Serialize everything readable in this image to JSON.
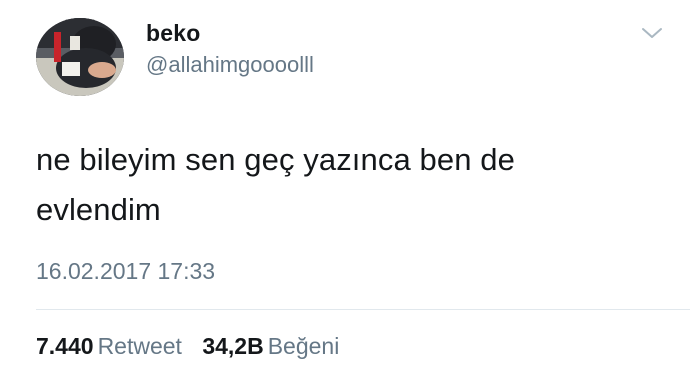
{
  "user": {
    "display_name": "beko",
    "handle": "@allahimgoooolll",
    "avatar_icon": "profile-photo"
  },
  "menu": {
    "icon": "chevron-down-icon"
  },
  "tweet": {
    "text": "ne bileyim sen geç yazınca ben de evlendim",
    "timestamp": "16.02.2017 17:33"
  },
  "stats": {
    "retweets": {
      "count": "7.440",
      "label": "Retweet"
    },
    "likes": {
      "count": "34,2B",
      "label": "Beğeni"
    }
  },
  "colors": {
    "text": "#14171a",
    "muted": "#657786",
    "divider": "#e1e8ed"
  }
}
